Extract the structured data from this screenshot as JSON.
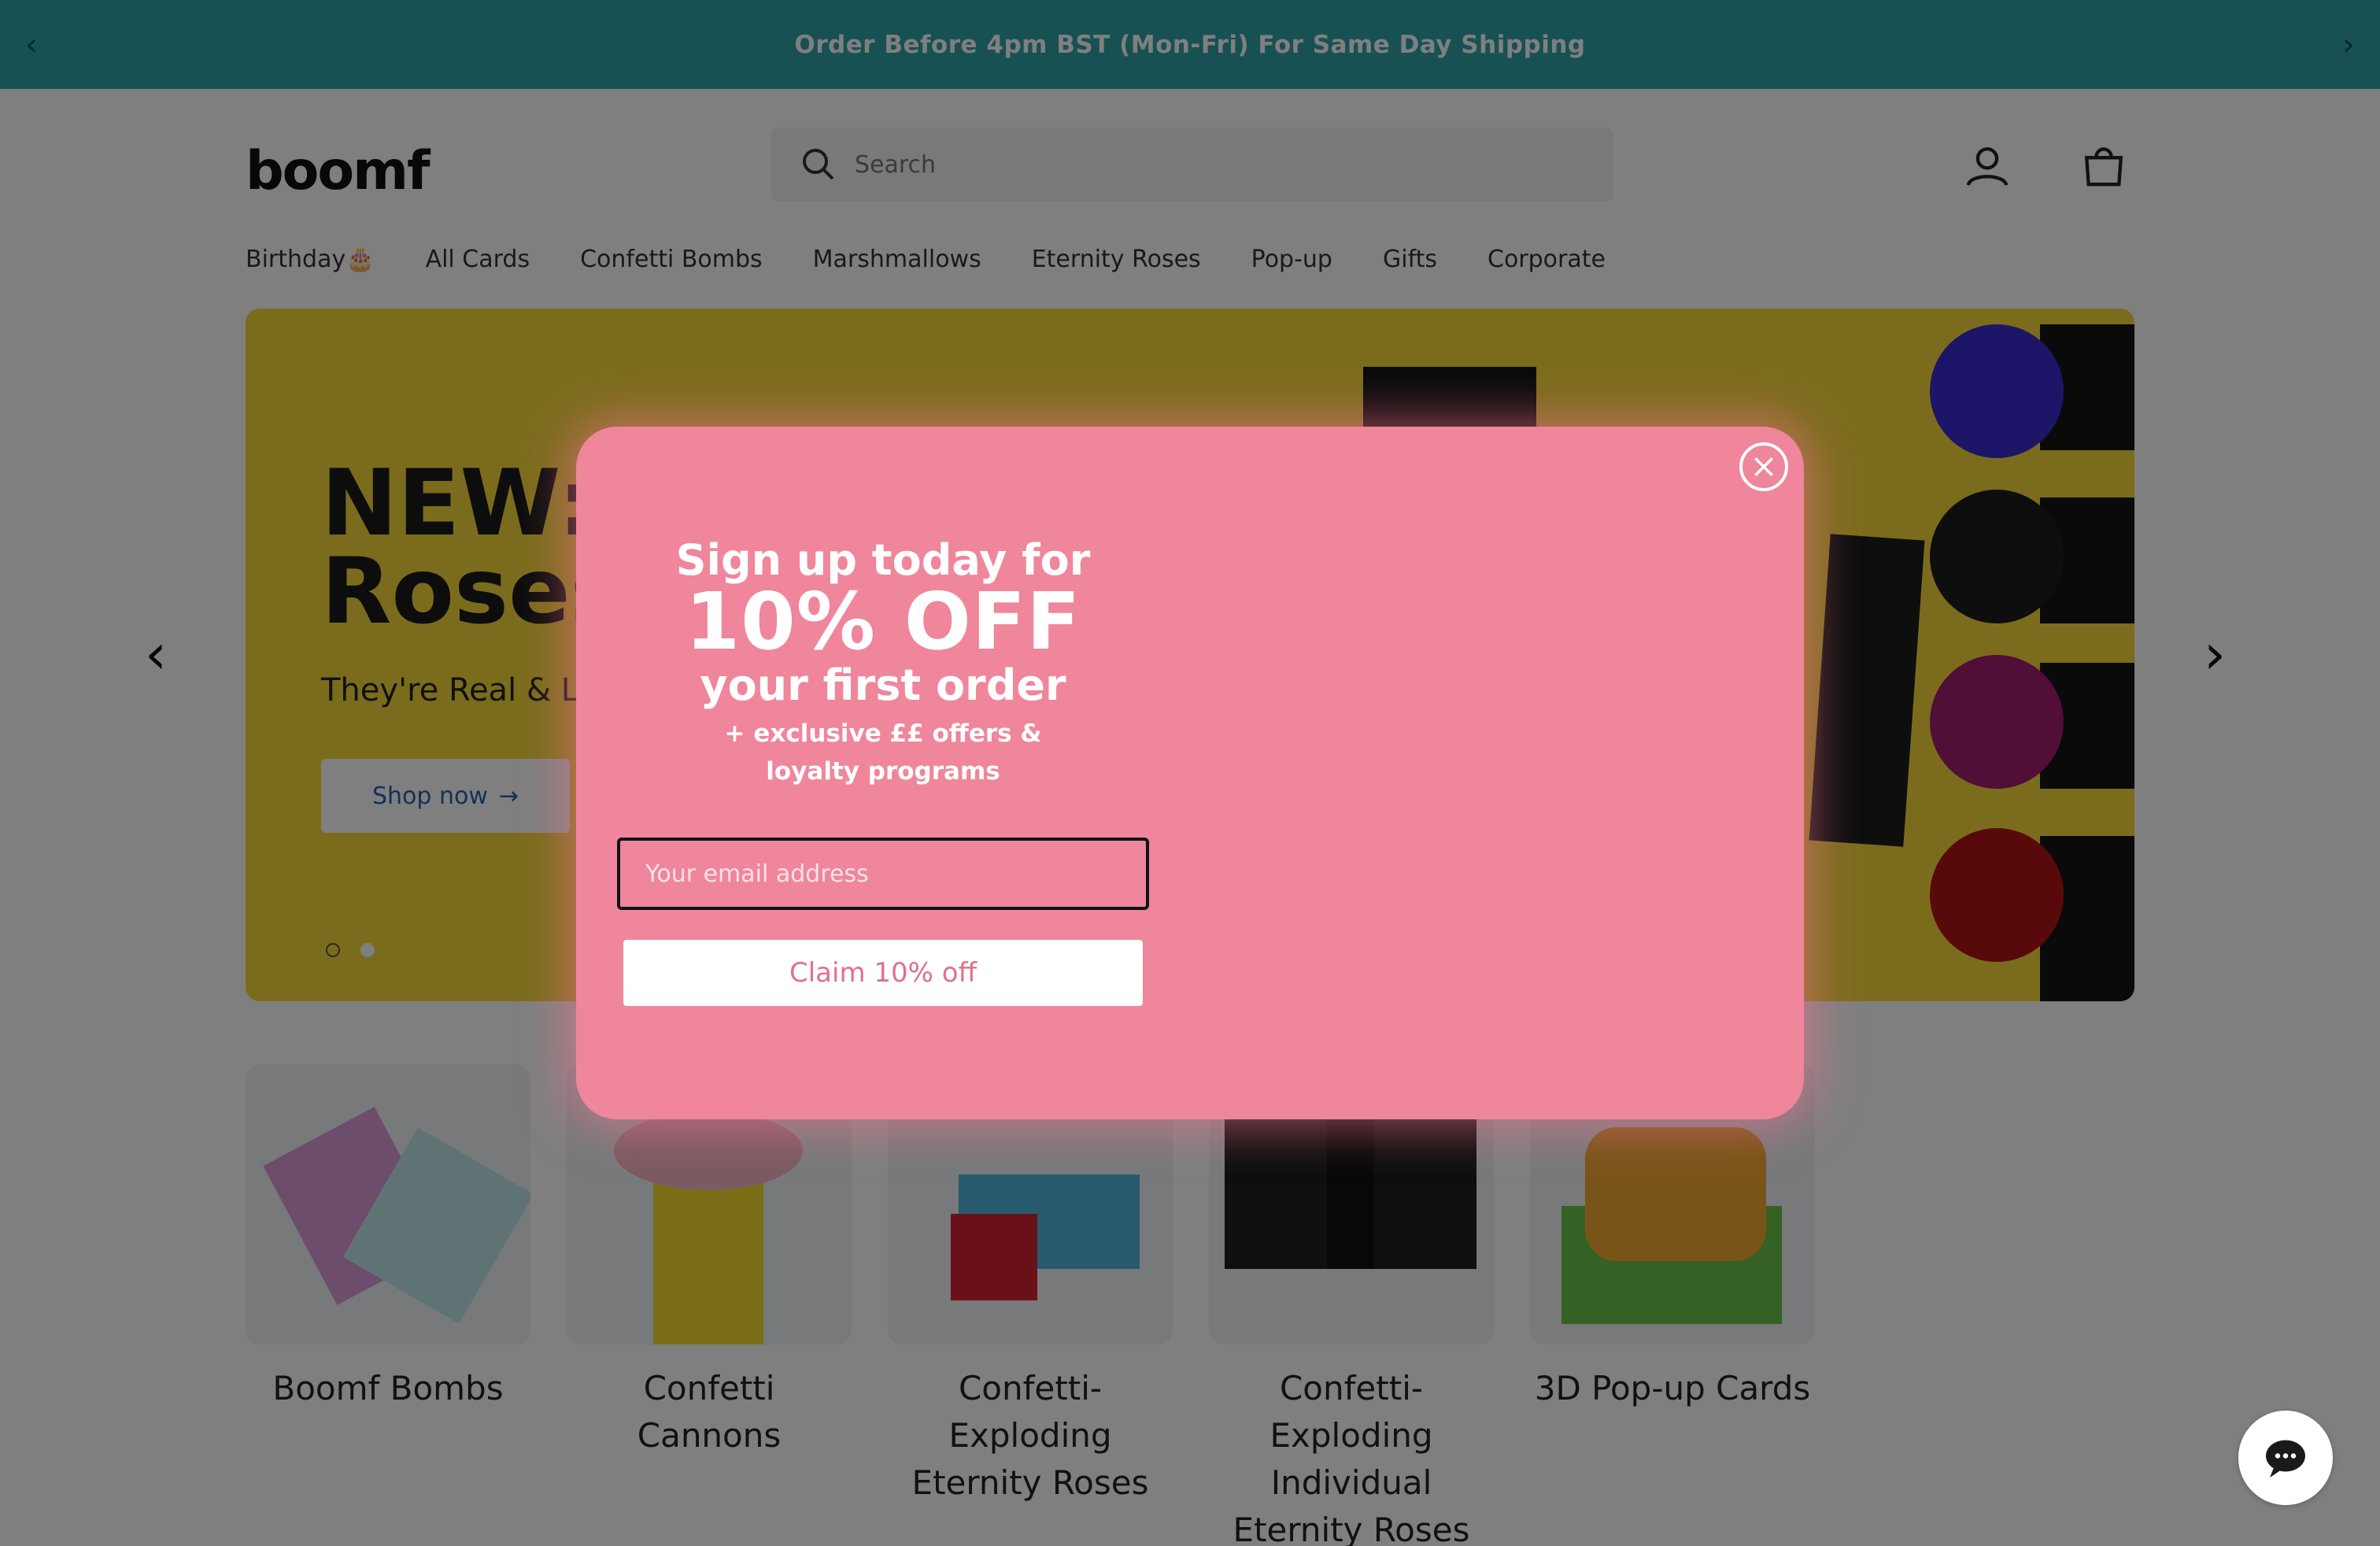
{
  "announcement": {
    "text": "Order Before 4pm BST (Mon-Fri) For Same Day Shipping",
    "prev_icon": "chevron-left-icon",
    "next_icon": "chevron-right-icon"
  },
  "header": {
    "logo": "boomf",
    "search_placeholder": "Search",
    "icons": [
      "search-icon",
      "account-icon",
      "cart-icon"
    ]
  },
  "nav": {
    "items": [
      "Birthday🎂",
      "All Cards",
      "Confetti Bombs",
      "Marshmallows",
      "Eternity Roses",
      "Pop-up",
      "Gifts",
      "Corporate"
    ]
  },
  "hero": {
    "title_line1": "NEW: Eternity",
    "title_line2": "Roses",
    "subtitle": "They're Real & Last",
    "button_label": "Shop now",
    "slide_count": 2,
    "active_slide": 2,
    "background": "#f7d83a"
  },
  "categories": [
    {
      "label": "Boomf Bombs"
    },
    {
      "label": "Confetti Cannons"
    },
    {
      "label": "Confetti-Exploding Eternity Roses"
    },
    {
      "label": "Confetti-Exploding Individual Eternity Roses"
    },
    {
      "label": "3D Pop-up Cards"
    }
  ],
  "modal": {
    "line1": "Sign up today for",
    "line2": "10% OFF",
    "line3": "your first order",
    "line4": "+ exclusive ££ offers & loyalty programs",
    "email_placeholder": "Your email address",
    "button_label": "Claim 10% off",
    "background": "#ef869b",
    "close_icon": "close-icon"
  },
  "chat": {
    "icon": "chat-bubble-icon"
  },
  "colors": {
    "announcement_bg": "#2fa3a8",
    "modal_bg": "#ef869b",
    "hero_bg": "#f7d83a"
  }
}
